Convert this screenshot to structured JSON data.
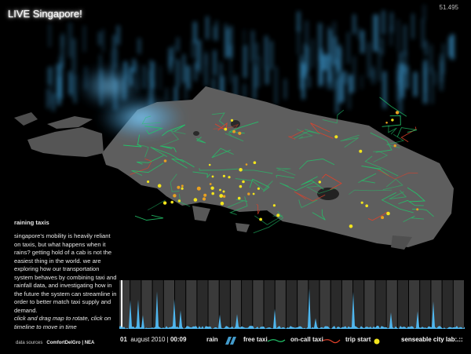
{
  "header": {
    "title": "LIVE Singapore!",
    "counter": "51.495"
  },
  "side": {
    "title": "raining taxis",
    "body": "singapore's mobility is heavily reliant on taxis, but what happens when it rains? getting hold of a cab is not the easiest thing in the world. we are exploring how our transportation system behaves by combining taxi and rainfall data, and investigating how in the future the system can streamline in order to better match taxi supply and demand.",
    "hint": "click and drag map to rotate, click on timeline to move in time"
  },
  "sources": {
    "label": "data sources",
    "providers": "ComfortDelGro | NEA"
  },
  "footer": {
    "day": "01",
    "month_year": "august 2010 |",
    "time": "00:09",
    "legend": {
      "rain": "rain",
      "free_taxi": "free taxi",
      "on_call_taxi": "on-call taxi",
      "trip_start": "trip start"
    },
    "brand": "senseable city lab:.::"
  },
  "colors": {
    "rain": "#4fb6ee",
    "free_taxi": "#22c46a",
    "on_call_taxi": "#e0412a",
    "trip_start": "#f2e41c",
    "land": "#5e5e5e"
  }
}
